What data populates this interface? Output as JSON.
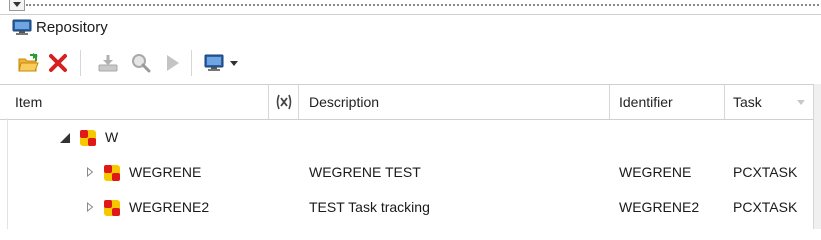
{
  "panel": {
    "title": "Repository"
  },
  "toolbar": {
    "buttons": [
      {
        "icon": "open-folder-icon",
        "enabled": true
      },
      {
        "icon": "delete-icon",
        "enabled": true
      },
      {
        "icon": "download-icon",
        "enabled": false
      },
      {
        "icon": "search-icon",
        "enabled": false
      },
      {
        "icon": "run-icon",
        "enabled": false
      },
      {
        "icon": "monitor-icon",
        "enabled": true
      }
    ]
  },
  "columns": {
    "item": "Item",
    "description": "Description",
    "identifier": "Identifier",
    "task": "Task"
  },
  "tree": {
    "root": {
      "label": "W",
      "expanded": true
    },
    "children": [
      {
        "label": "WEGRENE",
        "description": "WEGRENE TEST",
        "identifier": "WEGRENE",
        "task": "PCXTASK"
      },
      {
        "label": "WEGRENE2",
        "description": "TEST Task tracking",
        "identifier": "WEGRENE2",
        "task": "PCXTASK"
      }
    ]
  },
  "colors": {
    "accent": "#2a62a8",
    "delete": "#d42020",
    "folder": "#f2b431",
    "node_red": "#e01818",
    "node_yellow": "#f6c800"
  }
}
